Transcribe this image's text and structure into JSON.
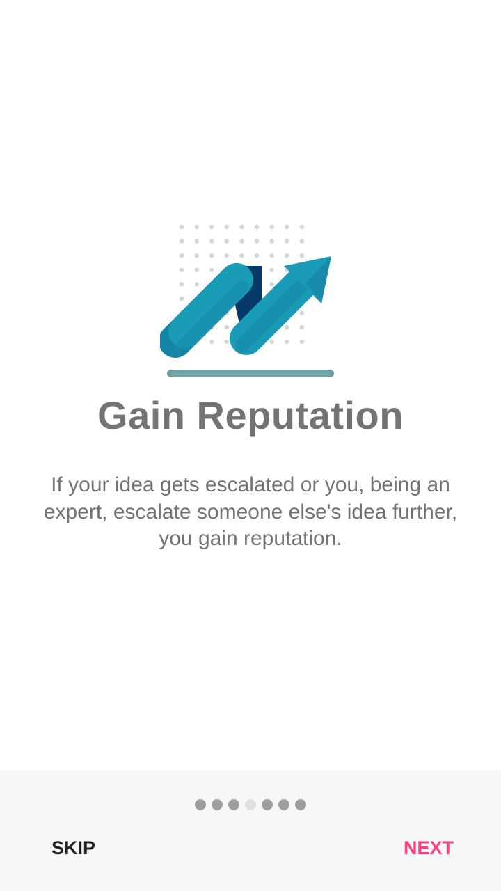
{
  "onboarding": {
    "title": "Gain Reputation",
    "description": "If your idea gets escalated or you, being an expert, escalate someone else's idea further, you gain reputation.",
    "illustration_icon": "trending-up-arrow-icon"
  },
  "pager": {
    "total_pages": 7,
    "current_page": 4
  },
  "footer": {
    "skip_label": "SKIP",
    "next_label": "NEXT"
  },
  "colors": {
    "title_text": "#737373",
    "description_text": "#737373",
    "next_accent": "#ff3f7f",
    "skip_text": "#222222",
    "arrow_primary": "#1a9bb5",
    "arrow_dark": "#063a6a",
    "baseline": "#6fa3a7",
    "dot_inactive": "#9e9e9e",
    "dot_active": "#e0e0e0",
    "footer_bg": "#f7f7f7"
  }
}
